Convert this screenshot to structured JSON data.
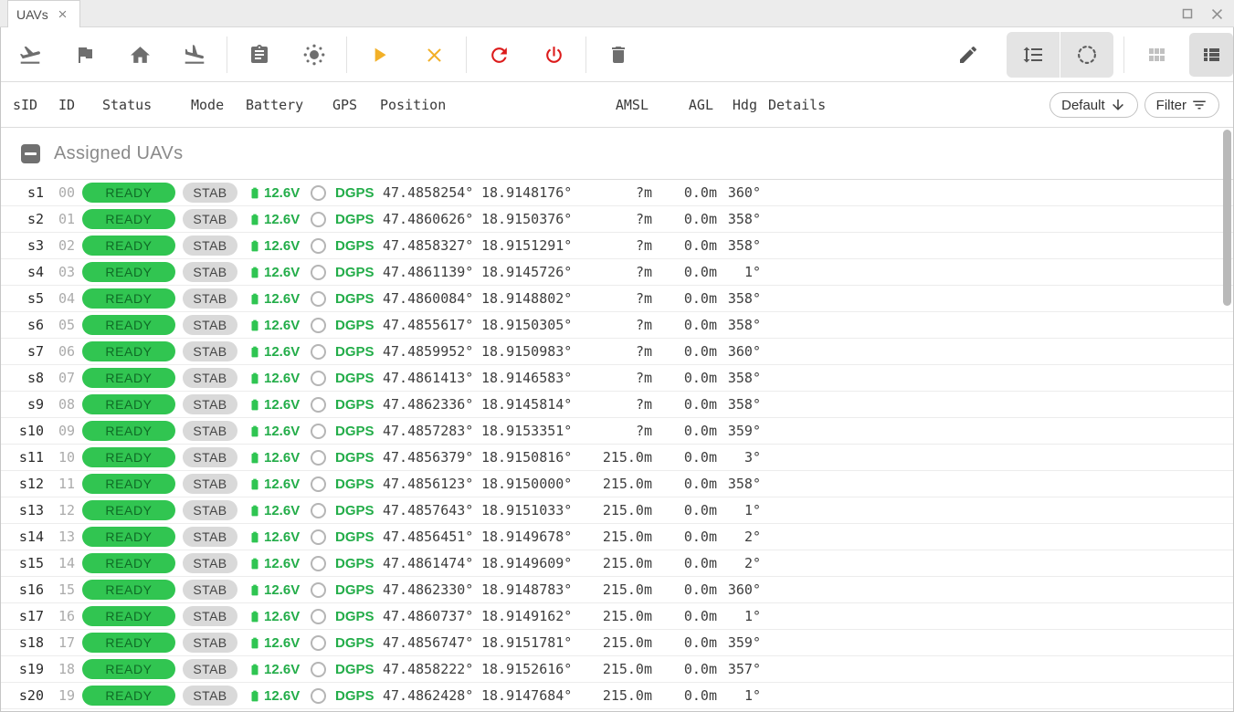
{
  "window": {
    "tab_title": "UAVs",
    "controls": [
      "maximize",
      "close"
    ]
  },
  "toolbar": {
    "left_icons": [
      "takeoff",
      "flag",
      "home",
      "land",
      "checklist",
      "sun",
      "play",
      "cancel",
      "refresh",
      "power",
      "trash"
    ],
    "right_icons": [
      "edit-pencil",
      "sort-by-line-spacing",
      "dashed-circle-selection",
      "grid-view",
      "list-view"
    ]
  },
  "filter_bar": {
    "preset_label": "Default",
    "filter_label": "Filter"
  },
  "columns": {
    "sid": "sID",
    "id": "ID",
    "status": "Status",
    "mode": "Mode",
    "battery": "Battery",
    "gps": "GPS",
    "position": "Position",
    "amsl": "AMSL",
    "agl": "AGL",
    "hdg": "Hdg",
    "details": "Details"
  },
  "section": {
    "title": "Assigned UAVs"
  },
  "rows": [
    {
      "sid": "s1",
      "id": "00",
      "status": "READY",
      "mode": "STAB",
      "battery": "12.6V",
      "gps": "DGPS",
      "lat": "47.4858254°",
      "lon": "18.9148176°",
      "amsl": "?m",
      "agl": "0.0m",
      "hdg": "360°"
    },
    {
      "sid": "s2",
      "id": "01",
      "status": "READY",
      "mode": "STAB",
      "battery": "12.6V",
      "gps": "DGPS",
      "lat": "47.4860626°",
      "lon": "18.9150376°",
      "amsl": "?m",
      "agl": "0.0m",
      "hdg": "358°"
    },
    {
      "sid": "s3",
      "id": "02",
      "status": "READY",
      "mode": "STAB",
      "battery": "12.6V",
      "gps": "DGPS",
      "lat": "47.4858327°",
      "lon": "18.9151291°",
      "amsl": "?m",
      "agl": "0.0m",
      "hdg": "358°"
    },
    {
      "sid": "s4",
      "id": "03",
      "status": "READY",
      "mode": "STAB",
      "battery": "12.6V",
      "gps": "DGPS",
      "lat": "47.4861139°",
      "lon": "18.9145726°",
      "amsl": "?m",
      "agl": "0.0m",
      "hdg": "1°"
    },
    {
      "sid": "s5",
      "id": "04",
      "status": "READY",
      "mode": "STAB",
      "battery": "12.6V",
      "gps": "DGPS",
      "lat": "47.4860084°",
      "lon": "18.9148802°",
      "amsl": "?m",
      "agl": "0.0m",
      "hdg": "358°"
    },
    {
      "sid": "s6",
      "id": "05",
      "status": "READY",
      "mode": "STAB",
      "battery": "12.6V",
      "gps": "DGPS",
      "lat": "47.4855617°",
      "lon": "18.9150305°",
      "amsl": "?m",
      "agl": "0.0m",
      "hdg": "358°"
    },
    {
      "sid": "s7",
      "id": "06",
      "status": "READY",
      "mode": "STAB",
      "battery": "12.6V",
      "gps": "DGPS",
      "lat": "47.4859952°",
      "lon": "18.9150983°",
      "amsl": "?m",
      "agl": "0.0m",
      "hdg": "360°"
    },
    {
      "sid": "s8",
      "id": "07",
      "status": "READY",
      "mode": "STAB",
      "battery": "12.6V",
      "gps": "DGPS",
      "lat": "47.4861413°",
      "lon": "18.9146583°",
      "amsl": "?m",
      "agl": "0.0m",
      "hdg": "358°"
    },
    {
      "sid": "s9",
      "id": "08",
      "status": "READY",
      "mode": "STAB",
      "battery": "12.6V",
      "gps": "DGPS",
      "lat": "47.4862336°",
      "lon": "18.9145814°",
      "amsl": "?m",
      "agl": "0.0m",
      "hdg": "358°"
    },
    {
      "sid": "s10",
      "id": "09",
      "status": "READY",
      "mode": "STAB",
      "battery": "12.6V",
      "gps": "DGPS",
      "lat": "47.4857283°",
      "lon": "18.9153351°",
      "amsl": "?m",
      "agl": "0.0m",
      "hdg": "359°"
    },
    {
      "sid": "s11",
      "id": "10",
      "status": "READY",
      "mode": "STAB",
      "battery": "12.6V",
      "gps": "DGPS",
      "lat": "47.4856379°",
      "lon": "18.9150816°",
      "amsl": "215.0m",
      "agl": "0.0m",
      "hdg": "3°"
    },
    {
      "sid": "s12",
      "id": "11",
      "status": "READY",
      "mode": "STAB",
      "battery": "12.6V",
      "gps": "DGPS",
      "lat": "47.4856123°",
      "lon": "18.9150000°",
      "amsl": "215.0m",
      "agl": "0.0m",
      "hdg": "358°"
    },
    {
      "sid": "s13",
      "id": "12",
      "status": "READY",
      "mode": "STAB",
      "battery": "12.6V",
      "gps": "DGPS",
      "lat": "47.4857643°",
      "lon": "18.9151033°",
      "amsl": "215.0m",
      "agl": "0.0m",
      "hdg": "1°"
    },
    {
      "sid": "s14",
      "id": "13",
      "status": "READY",
      "mode": "STAB",
      "battery": "12.6V",
      "gps": "DGPS",
      "lat": "47.4856451°",
      "lon": "18.9149678°",
      "amsl": "215.0m",
      "agl": "0.0m",
      "hdg": "2°"
    },
    {
      "sid": "s15",
      "id": "14",
      "status": "READY",
      "mode": "STAB",
      "battery": "12.6V",
      "gps": "DGPS",
      "lat": "47.4861474°",
      "lon": "18.9149609°",
      "amsl": "215.0m",
      "agl": "0.0m",
      "hdg": "2°"
    },
    {
      "sid": "s16",
      "id": "15",
      "status": "READY",
      "mode": "STAB",
      "battery": "12.6V",
      "gps": "DGPS",
      "lat": "47.4862330°",
      "lon": "18.9148783°",
      "amsl": "215.0m",
      "agl": "0.0m",
      "hdg": "360°"
    },
    {
      "sid": "s17",
      "id": "16",
      "status": "READY",
      "mode": "STAB",
      "battery": "12.6V",
      "gps": "DGPS",
      "lat": "47.4860737°",
      "lon": "18.9149162°",
      "amsl": "215.0m",
      "agl": "0.0m",
      "hdg": "1°"
    },
    {
      "sid": "s18",
      "id": "17",
      "status": "READY",
      "mode": "STAB",
      "battery": "12.6V",
      "gps": "DGPS",
      "lat": "47.4856747°",
      "lon": "18.9151781°",
      "amsl": "215.0m",
      "agl": "0.0m",
      "hdg": "359°"
    },
    {
      "sid": "s19",
      "id": "18",
      "status": "READY",
      "mode": "STAB",
      "battery": "12.6V",
      "gps": "DGPS",
      "lat": "47.4858222°",
      "lon": "18.9152616°",
      "amsl": "215.0m",
      "agl": "0.0m",
      "hdg": "357°"
    },
    {
      "sid": "s20",
      "id": "19",
      "status": "READY",
      "mode": "STAB",
      "battery": "12.6V",
      "gps": "DGPS",
      "lat": "47.4862428°",
      "lon": "18.9147684°",
      "amsl": "215.0m",
      "agl": "0.0m",
      "hdg": "1°"
    }
  ],
  "colors": {
    "status_green": "#31c551",
    "green_text_dark": "#0f6b26",
    "telemetry_green": "#23ad49",
    "battery_icon_green": "#2fc552",
    "mode_pill_bg": "#d9d9d9",
    "mode_pill_text": "#454545",
    "amber": "#f2b028",
    "red": "#dc1b1b",
    "icon_gray": "#6e6e6e",
    "row_text": "#3d3d3d",
    "muted_text": "#ababab"
  }
}
